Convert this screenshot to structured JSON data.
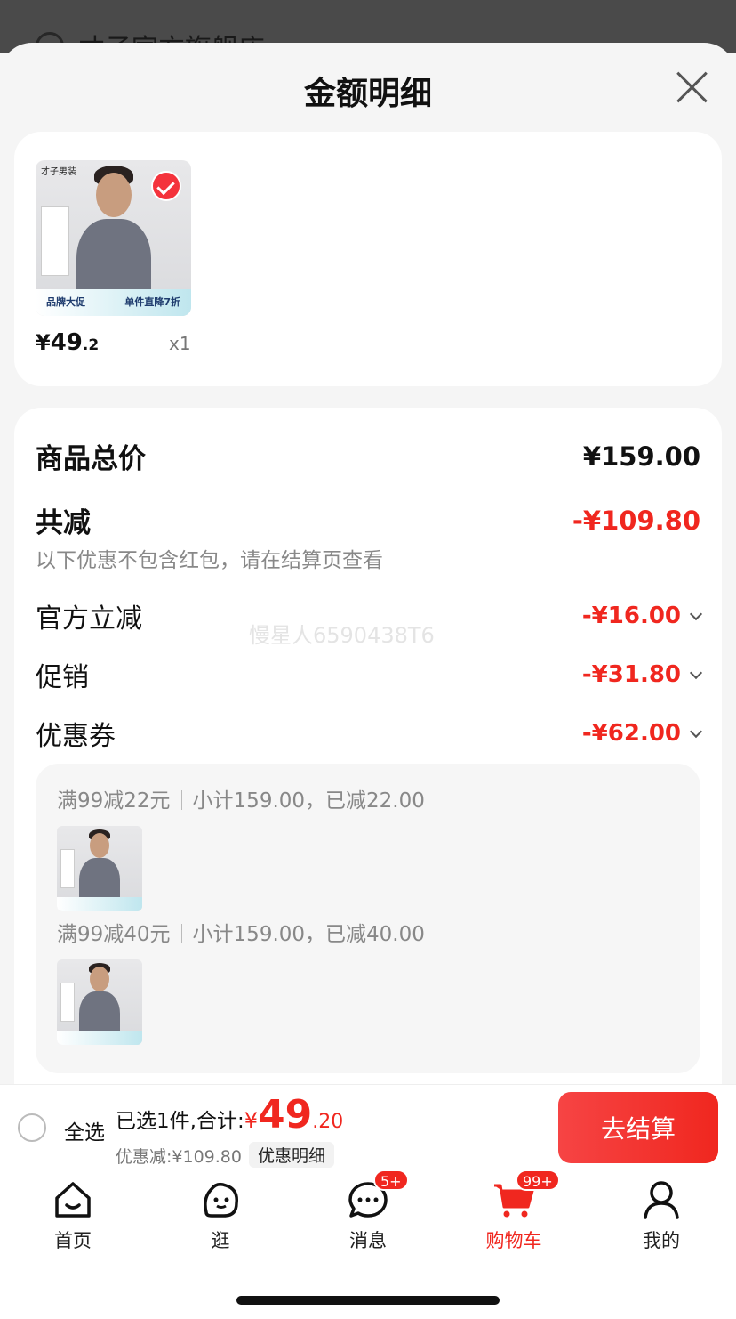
{
  "background_store": {
    "name": "才子官方旗舰店 ›"
  },
  "sheet": {
    "title": "金额明细"
  },
  "product": {
    "brand": "才子男装",
    "banner_left": "品牌大促",
    "banner_right": "单件直降7折",
    "price_yen": "¥",
    "price_main": "49",
    "price_dec": ".2",
    "qty": "x1"
  },
  "detail": {
    "total_label": "商品总价",
    "total_value": "¥159.00",
    "reduce_label": "共减",
    "reduce_value": "-¥109.80",
    "note": "以下优惠不包含红包，请在结算页查看",
    "watermark": "慢星人6590438T6",
    "items": [
      {
        "label": "官方立减",
        "value": "-¥16.00"
      },
      {
        "label": "促销",
        "value": "-¥31.80"
      },
      {
        "label": "优惠券",
        "value": "-¥62.00"
      }
    ],
    "coupons": [
      {
        "rule": "满99减22元",
        "subtotal": "小计159.00，已减22.00"
      },
      {
        "rule": "满99减40元",
        "subtotal": "小计159.00，已减40.00"
      }
    ]
  },
  "checkout": {
    "select_all": "全选",
    "summary_prefix": "已选1件,合计:",
    "total_yen": "¥",
    "total_big": "49",
    "total_dec": ".20",
    "saved": "优惠减:¥109.80",
    "detail_tag": "优惠明细",
    "button": "去结算"
  },
  "tabbar": {
    "items": [
      {
        "label": "首页",
        "icon": "home-icon"
      },
      {
        "label": "逛",
        "icon": "browse-icon"
      },
      {
        "label": "消息",
        "icon": "message-icon",
        "badge": "5+"
      },
      {
        "label": "购物车",
        "icon": "cart-icon",
        "badge": "99+",
        "active": true
      },
      {
        "label": "我的",
        "icon": "profile-icon"
      }
    ]
  },
  "colors": {
    "accent": "#f0271f",
    "muted": "#888888"
  }
}
